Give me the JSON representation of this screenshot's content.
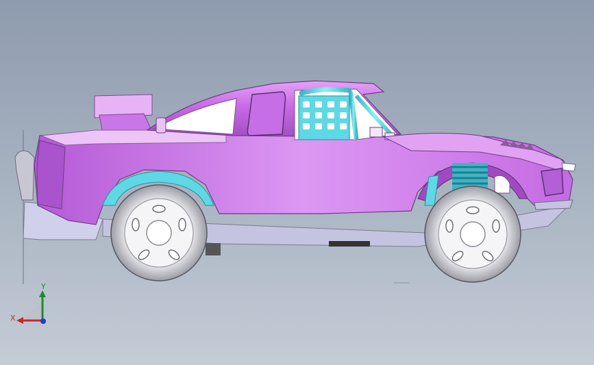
{
  "viewport": {
    "background_top": "#8e9bae",
    "background_bottom": "#c4ccd6"
  },
  "model": {
    "body_color": "#cf72ec",
    "rollcage_color": "#5ed8e4",
    "tire_color": "#d8d8dc",
    "chassis_color": "#cfd0e8"
  },
  "triad": {
    "x_label": "X",
    "y_label": "Y",
    "x_color": "#c62828",
    "y_color": "#1e8a2e",
    "z_color": "#1e3fd0"
  }
}
